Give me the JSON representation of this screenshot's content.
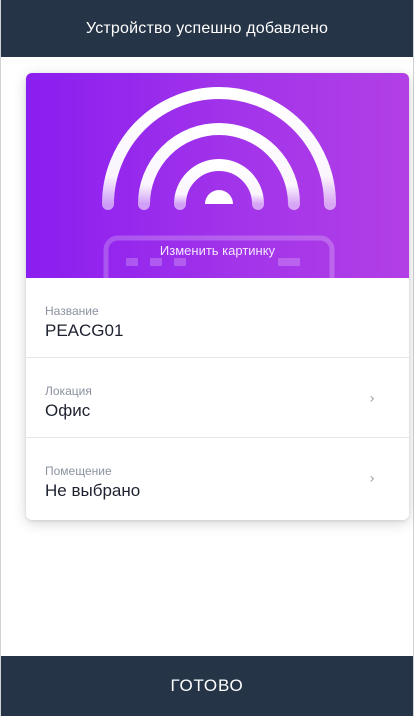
{
  "header": {
    "title": "Устройство успешно добавлено"
  },
  "hero": {
    "change_image_label": "Изменить картинку",
    "gradient_start": "#8b1df0",
    "gradient_end": "#b23fe6",
    "icon": "wifi-signal-icon"
  },
  "fields": [
    {
      "label": "Название",
      "value": "PEACG01"
    },
    {
      "label": "Локация",
      "value": "Офис",
      "chevron": "›"
    },
    {
      "label": "Помещение",
      "value": "Не выбрано",
      "chevron": "›"
    }
  ],
  "footer": {
    "done_label": "ГОТОВО"
  },
  "colors": {
    "bar": "#263447",
    "card": "#ffffff",
    "label": "#8c91a0",
    "value": "#1e2230"
  }
}
